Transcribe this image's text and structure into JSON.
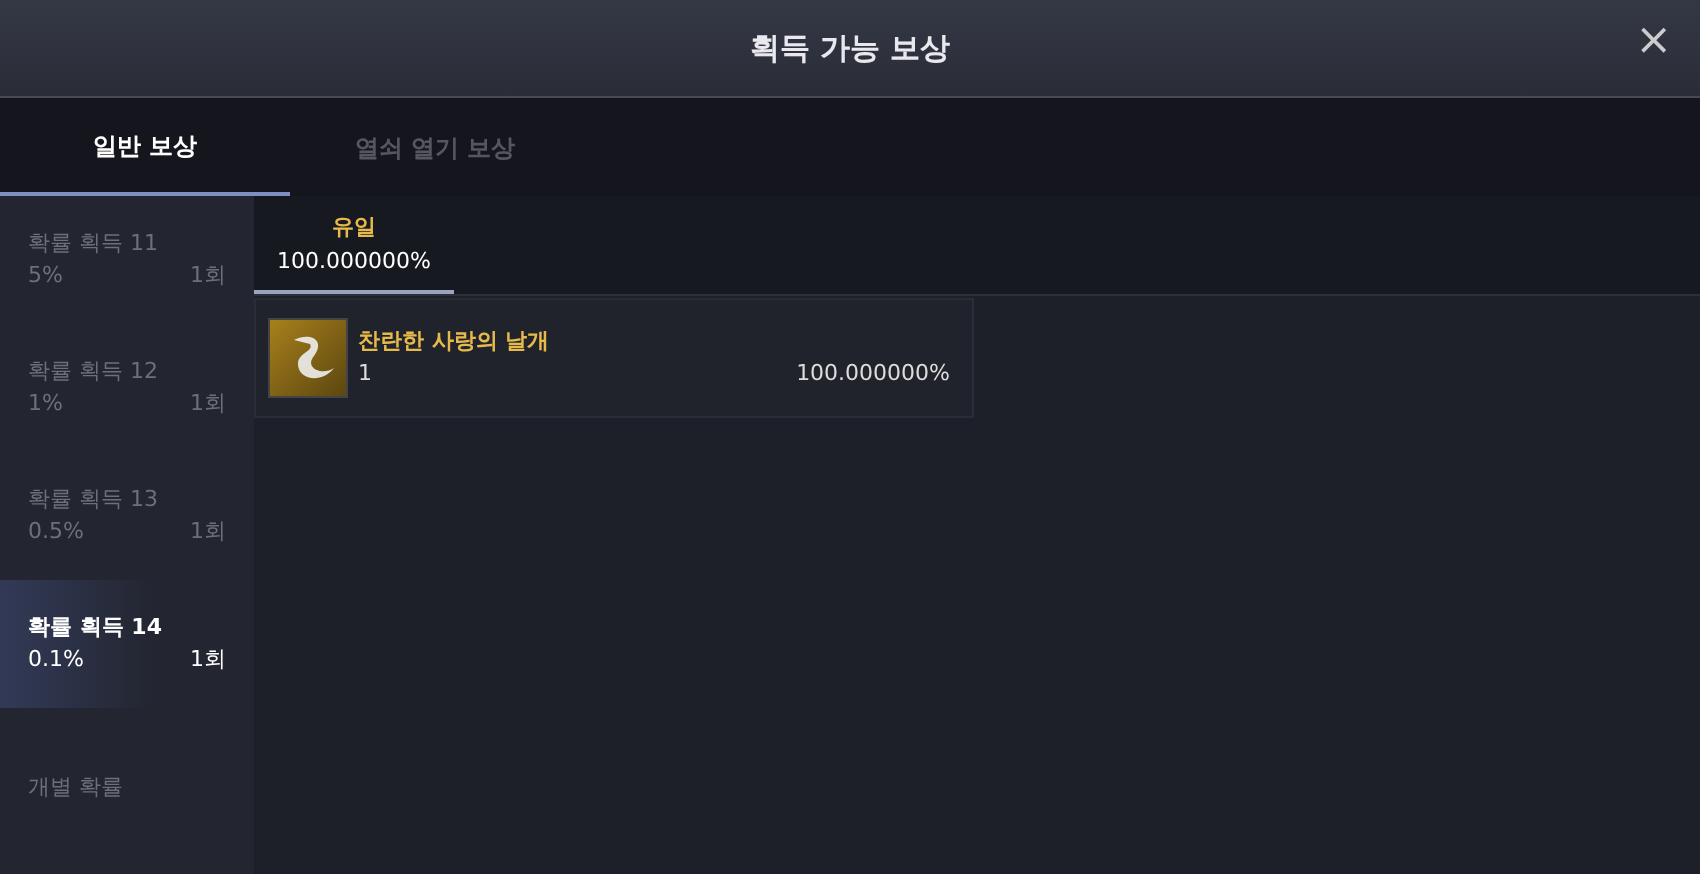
{
  "window": {
    "title": "획득 가능 보상",
    "close": "×"
  },
  "tabs": [
    {
      "label": "일반 보상",
      "selected": true
    },
    {
      "label": "열쇠 열기 보상",
      "selected": false
    }
  ],
  "sidebar": {
    "items": [
      {
        "kind": "tier",
        "name": "확률 획득 11",
        "rate": "5%",
        "count": "1회",
        "selected": false
      },
      {
        "kind": "tier",
        "name": "확률 획득 12",
        "rate": "1%",
        "count": "1회",
        "selected": false
      },
      {
        "kind": "tier",
        "name": "확률 획득 13",
        "rate": "0.5%",
        "count": "1회",
        "selected": false
      },
      {
        "kind": "tier",
        "name": "확률 획득 14",
        "rate": "0.1%",
        "count": "1회",
        "selected": true
      },
      {
        "kind": "link",
        "name": "개별 확률",
        "selected": false
      }
    ]
  },
  "grades": [
    {
      "label": "유일",
      "rate": "100.000000%",
      "selected": true
    }
  ],
  "rewards": [
    {
      "name": "찬란한 사랑의 날개",
      "quantity": "1",
      "rate": "100.000000%"
    }
  ]
}
